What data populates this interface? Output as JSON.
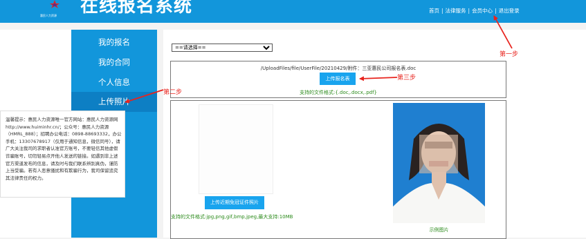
{
  "header": {
    "logo_text": "惠民人力资源",
    "title": "在线报名系统",
    "nav": [
      "首页",
      "法律服务",
      "会员中心",
      "退出登录"
    ]
  },
  "sidebar": {
    "items": [
      "我的报名",
      "我的合同",
      "个人信息",
      "上传照片"
    ]
  },
  "form": {
    "select_value": "==请选择==",
    "file_path": "/UploadFiles/file/UserFile/20210429/附件：三亚惠民公司报名表.doc",
    "upload_form_label": "上传报名表",
    "form_formats": "支持的文件格式:{.doc,.docx,.pdf}",
    "upload_photo_label": "上传近期免冠证件照片",
    "photo_formats": "支持的文件格式:jpg,png,gif,bmp,jpeg,最大支持:10MB",
    "sample_caption": "示例图片"
  },
  "notice": "温馨提示：惠民人力资源唯一官方网站：惠民人力资源网http://www.huiminhr.cn/；公众号：惠民人力资源（HMRL_888）；招聘办公电话：0898-88693332，办公手机：13307678917（仅用于通知信息，微信同号），请广大关注我司的求职者认准官方账号，不要轻信其他虚假诈骗账号，切勿轻易点开他人发送的链接。如遇到非上述官方渠道发布的信息，请及时与我们联系辨别真伪，谨防上当受骗。若有人恶意骚扰和有欺骗行为，我司保留追究其法律责任的权力。",
  "annotations": {
    "step1": "第一步",
    "step2": "第二步",
    "step3": "第三步"
  },
  "colors": {
    "header_blue": "#1296db",
    "button_blue": "#19a4ee",
    "annotation_red": "#e8241e",
    "hint_green": "#2a8a1a"
  }
}
